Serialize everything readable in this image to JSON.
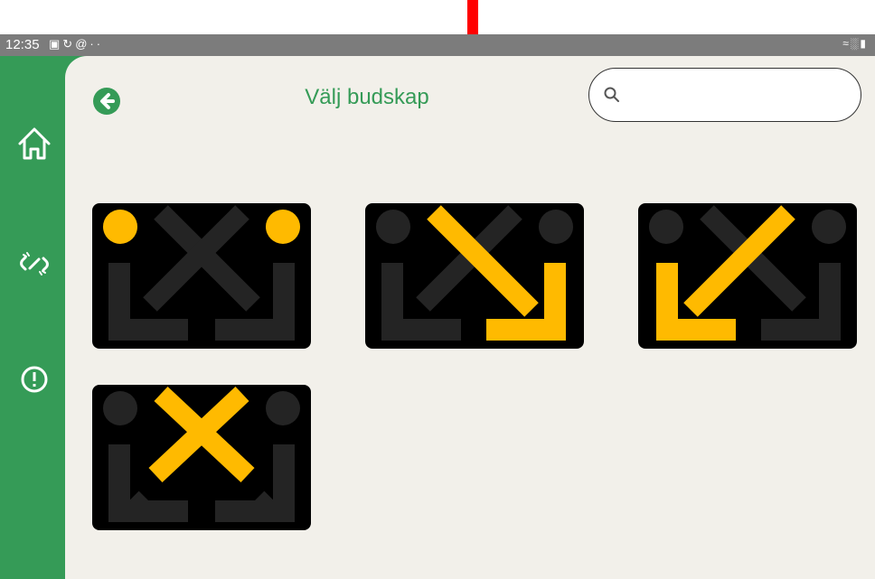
{
  "status_bar": {
    "time": "12:35",
    "left_icons": [
      "image-icon",
      "sync-icon",
      "at-icon",
      "more-icon"
    ],
    "right_icons": [
      "wifi-icon",
      "signal-icon",
      "battery-icon"
    ]
  },
  "sidebar": {
    "items": [
      {
        "icon": "home-icon"
      },
      {
        "icon": "unlink-icon"
      },
      {
        "icon": "alert-icon"
      }
    ]
  },
  "header": {
    "back_icon": "arrow-left-circle-icon",
    "title": "Välj budskap",
    "search": {
      "value": "",
      "placeholder": "",
      "icon": "search-icon"
    }
  },
  "messages": [
    {
      "id": "yellow-lights",
      "lit": [
        "lamp-left",
        "lamp-right"
      ]
    },
    {
      "id": "arrow-down-right",
      "lit": [
        "arrow-down-right"
      ]
    },
    {
      "id": "arrow-down-left",
      "lit": [
        "arrow-down-left"
      ]
    },
    {
      "id": "cross",
      "lit": [
        "cross"
      ]
    }
  ],
  "colors": {
    "brand_green": "#359b57",
    "sign_amber": "#ffba00",
    "sign_dim": "#242424",
    "annotation_red": "#ff0000"
  }
}
